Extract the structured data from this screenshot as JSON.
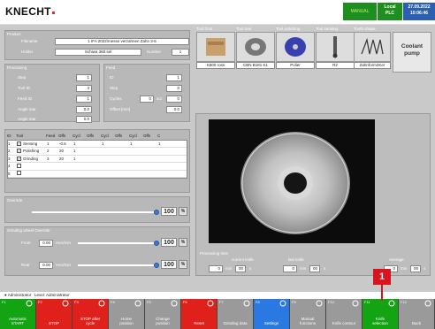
{
  "header": {
    "brand": "KNECHT",
    "mode": "MANUAL",
    "control": [
      "Local",
      "PLC"
    ],
    "datetime": [
      "27.09.2022",
      "10:06:46"
    ]
  },
  "product": {
    "title": "Product",
    "filename_label": "Filename",
    "filename": "1 IFA 2022\\messe verzahnen Zahn 3-5",
    "holder_label": "Holder",
    "holder": "Schiwa 360.sel",
    "number_label": "Number",
    "number": "1"
  },
  "tools": [
    {
      "title": "Tool front",
      "caption": "K800 ross"
    },
    {
      "title": "Tool rear",
      "caption": "CBN B181 K1"
    },
    {
      "title": "Tool polishing",
      "caption": "Polier"
    },
    {
      "title": "Tool sensing",
      "caption": "R2"
    },
    {
      "title": "Tooth shape",
      "caption": "Zahnform2Ker"
    }
  ],
  "coolant": "Coolant pump",
  "processing": {
    "title": "Processing",
    "step_label": "Step",
    "step": "1",
    "toolid_label": "Tool ID",
    "toolid": "4",
    "feedid_label": "Feed ID",
    "feedid": "1",
    "angle_rear_label": "Angle rear",
    "angle_rear": "0.0",
    "angle_rear2_label": "Angle rear",
    "angle_rear2": "0.0"
  },
  "feed": {
    "title": "Feed",
    "id_label": "ID",
    "id": "1",
    "step_label": "Step",
    "step": "0",
    "cycles_label": "Cycles",
    "cycles": "0",
    "act_label": "act",
    "act": "0",
    "offset_label": "Offset [mm]",
    "offset": "0.0"
  },
  "tool_table": {
    "headers": [
      "ID",
      "Tool",
      "Feed",
      "Offs",
      "Cycl",
      "Offs",
      "Cycl",
      "Offs",
      "Cycl",
      "Offs",
      "C"
    ],
    "rows": [
      {
        "id": "1",
        "checked": true,
        "tool": "Sensing",
        "feed": "1",
        "offs": "-0.6",
        "cycl": "1",
        "offs2": "",
        "cycl2": "1",
        "offs3": "",
        "cycl3": "1",
        "offs4": "",
        "c": "1"
      },
      {
        "id": "2",
        "checked": true,
        "tool": "Polishing",
        "feed": "2",
        "offs": "20",
        "cycl": "1",
        "offs2": "",
        "cycl2": "",
        "offs3": "",
        "cycl3": "",
        "offs4": "",
        "c": ""
      },
      {
        "id": "3",
        "checked": true,
        "tool": "Grinding",
        "feed": "3",
        "offs": "20",
        "cycl": "1",
        "offs2": "",
        "cycl2": "",
        "offs3": "",
        "cycl3": "",
        "offs4": "",
        "c": ""
      },
      {
        "id": "4",
        "checked": false,
        "tool": "",
        "feed": "",
        "offs": "",
        "cycl": "",
        "offs2": "",
        "cycl2": "",
        "offs3": "",
        "cycl3": "",
        "offs4": "",
        "c": ""
      },
      {
        "id": "5",
        "checked": false,
        "tool": "",
        "feed": "",
        "offs": "",
        "cycl": "",
        "offs2": "",
        "cycl2": "",
        "offs3": "",
        "cycl3": "",
        "offs4": "",
        "c": ""
      }
    ]
  },
  "override": {
    "title": "Override",
    "value": "100",
    "unit": "%",
    "level": 1.0
  },
  "grinding": {
    "title": "Grinding wheel Override",
    "front_label": "Front",
    "front_speed": "0.00",
    "speed_unit": "revs/min",
    "front_value": "100",
    "front_unit": "%",
    "front_level": 1.0,
    "rear_label": "Rear",
    "rear_speed": "0.00",
    "rear_value": "100",
    "rear_unit": "%",
    "rear_level": 1.0
  },
  "processing_time": {
    "title": "Processing time",
    "current_label": "current knife",
    "current_min": "0",
    "current_s": "00",
    "last_label": "last knife",
    "last_min": "0",
    "last_s": "00",
    "avg_label": "Average",
    "avg_min": "0",
    "avg_s": "00",
    "min_unit": "min",
    "s_unit": "s"
  },
  "status": {
    "user": "Administrator",
    "level": "Level: Administrator"
  },
  "fkeys": [
    {
      "key": "F1",
      "label": "Automatic\nSTART",
      "color": "#13a313"
    },
    {
      "key": "F2",
      "label": "STOP",
      "color": "#e0201a"
    },
    {
      "key": "F3",
      "label": "STOP after\ncycle",
      "color": "#e0201a"
    },
    {
      "key": "F4",
      "label": "Home\nposition",
      "color": "#9a9a9a"
    },
    {
      "key": "F5",
      "label": "Change\nposition",
      "color": "#9a9a9a"
    },
    {
      "key": "F6",
      "label": "Reset",
      "color": "#e0201a"
    },
    {
      "key": "F7",
      "label": "Grinding data",
      "color": "#9a9a9a"
    },
    {
      "key": "F8",
      "label": "Settings",
      "color": "#2a79e0"
    },
    {
      "key": "F9",
      "label": "Manual\nfunctions",
      "color": "#9a9a9a"
    },
    {
      "key": "F10",
      "label": "Knife contour",
      "color": "#9a9a9a"
    },
    {
      "key": "F11",
      "label": "Knife\nselection",
      "color": "#13a313"
    },
    {
      "key": "F12",
      "label": "Back",
      "color": "#9a9a9a"
    }
  ],
  "callout": "1"
}
